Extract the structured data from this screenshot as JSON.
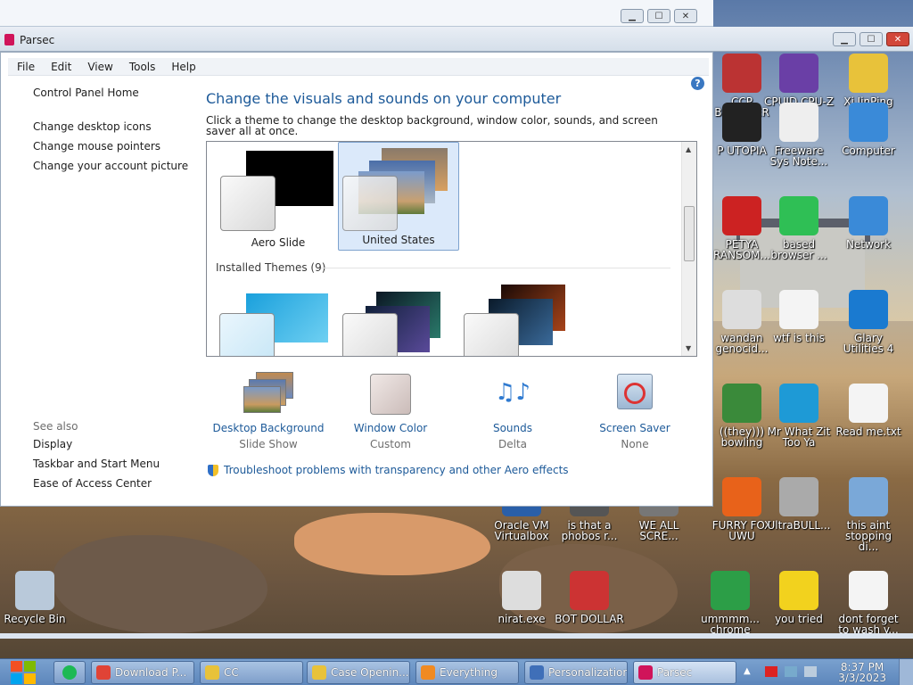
{
  "parsec": {
    "title": "Parsec"
  },
  "menubar": [
    "File",
    "Edit",
    "View",
    "Tools",
    "Help"
  ],
  "nav": {
    "home": "Control Panel Home",
    "links": [
      "Change desktop icons",
      "Change mouse pointers",
      "Change your account picture"
    ],
    "see_also_title": "See also",
    "see_also": [
      "Display",
      "Taskbar and Start Menu",
      "Ease of Access Center"
    ]
  },
  "main": {
    "heading": "Change the visuals and sounds on your computer",
    "subtitle": "Click a theme to change the desktop background, window color, sounds, and screen saver all at once.",
    "themes": [
      {
        "name": "Aero Slide",
        "selected": false
      },
      {
        "name": "United States",
        "selected": true
      }
    ],
    "installed_label": "Installed Themes (9)",
    "settings": [
      {
        "label": "Desktop Background",
        "value": "Slide Show",
        "icon": "desktop-background-icon"
      },
      {
        "label": "Window Color",
        "value": "Custom",
        "icon": "window-color-icon"
      },
      {
        "label": "Sounds",
        "value": "Delta",
        "icon": "sounds-icon"
      },
      {
        "label": "Screen Saver",
        "value": "None",
        "icon": "screen-saver-icon"
      }
    ],
    "troubleshoot": "Troubleshoot problems with transparency and other Aero effects"
  },
  "desktop_icons": [
    {
      "label": "CCP BROWSER",
      "color": "#b33"
    },
    {
      "label": "CPUID CPU-Z",
      "color": "#6a3fa6"
    },
    {
      "label": "Xi JinPing",
      "color": "#e8c23a"
    },
    {
      "label": "P UTOPIA",
      "color": "#222"
    },
    {
      "label": "Freeware Sys Note...",
      "color": "#eee"
    },
    {
      "label": "Computer",
      "color": "#3a8ad8"
    },
    {
      "label": "PETYA RANSOM...",
      "color": "#c22"
    },
    {
      "label": "based browser ...",
      "color": "#2fbf55"
    },
    {
      "label": "Network",
      "color": "#3a8ad8"
    },
    {
      "label": "wandan genocid...",
      "color": "#ddd"
    },
    {
      "label": "wtf is this",
      "color": "#f4f4f4"
    },
    {
      "label": "Glary Utilities 4",
      "color": "#1a7ad0"
    },
    {
      "label": "((they))) bowling",
      "color": "#3a8a3a"
    },
    {
      "label": "Mr What Zit Too Ya",
      "color": "#1e9ad6"
    },
    {
      "label": "Read me.txt",
      "color": "#f4f4f4"
    },
    {
      "label": "FURRY FOX UWU",
      "color": "#e8621a"
    },
    {
      "label": "UltraBULL...",
      "color": "#aaa"
    },
    {
      "label": "this aint stopping di...",
      "color": "#7aa8d8"
    },
    {
      "label": "Oracle VM Virtualbox",
      "color": "#2a5fa8"
    },
    {
      "label": "is that a phobos r...",
      "color": "#555"
    },
    {
      "label": "WE ALL SCRE...",
      "color": "#777"
    },
    {
      "label": "nirat.exe",
      "color": "#ddd"
    },
    {
      "label": "BOT DOLLAR",
      "color": "#c33"
    },
    {
      "label": "ummmm... chrome",
      "color": "#2c9e47"
    },
    {
      "label": "you tried",
      "color": "#f2d21e"
    },
    {
      "label": "dont forget to wash y...",
      "color": "#f4f4f4"
    },
    {
      "label": "Recycle Bin",
      "color": "#b9c9da"
    }
  ],
  "taskbar": {
    "buttons": [
      {
        "label": "Download P...",
        "color": "#e04336"
      },
      {
        "label": "CC",
        "color": "#e8c23a"
      },
      {
        "label": "Case Openin...",
        "color": "#e8c23a"
      },
      {
        "label": "Everything",
        "color": "#f08a22"
      },
      {
        "label": "Personalization",
        "color": "#3f6fb8"
      },
      {
        "label": "Parsec",
        "color": "#d0145a"
      }
    ],
    "time": "8:37 PM",
    "date": "3/3/2023"
  }
}
